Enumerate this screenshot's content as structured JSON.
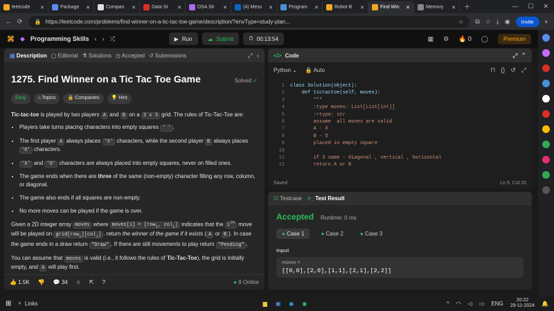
{
  "browser": {
    "tabs": [
      {
        "title": "leetcode",
        "color": "#f5a623"
      },
      {
        "title": "Package",
        "color": "#5b8def"
      },
      {
        "title": "Compan",
        "color": "#e0e0e0"
      },
      {
        "title": "Data St",
        "color": "#d93025"
      },
      {
        "title": "DSA Sh",
        "color": "#a76bf0"
      },
      {
        "title": "(4) Mess",
        "color": "#0a66c2"
      },
      {
        "title": "Program",
        "color": "#4a90d9"
      },
      {
        "title": "Robot B",
        "color": "#f5a623"
      },
      {
        "title": "Find Win",
        "color": "#f5a623"
      },
      {
        "title": "Memory",
        "color": "#888888"
      }
    ],
    "url": "https://leetcode.com/problems/find-winner-on-a-tic-tac-toe-game/description/?envType=study-plan...",
    "invite_label": "Invite"
  },
  "lc": {
    "list_title": "Programming Skills",
    "run": "Run",
    "submit": "Submit",
    "timer": "00:13:54",
    "streak": "0",
    "premium": "Premium"
  },
  "left": {
    "tabs": [
      "Description",
      "Editorial",
      "Solutions",
      "Accepted",
      "Submissions"
    ],
    "title": "1275. Find Winner on a Tic Tac Toe Game",
    "solved": "Solved",
    "tags": [
      "Easy",
      "Topics",
      "Companies",
      "Hint"
    ],
    "footer": {
      "likes": "1.5K",
      "comments": "34",
      "online": "9 Online"
    }
  },
  "editor": {
    "header": "Code",
    "language": "Python",
    "auto": "Auto",
    "status_left": "Saved",
    "status_right": "Ln 5, Col 20",
    "lines": [
      {
        "n": "1",
        "t": "class Solution(object):"
      },
      {
        "n": "2",
        "t": "    def tictactoe(self, moves):"
      },
      {
        "n": "3",
        "t": "        \"\"\""
      },
      {
        "n": "4",
        "t": "        :type moves: List[List[int]]"
      },
      {
        "n": "5",
        "t": "        :rtype: str"
      },
      {
        "n": "6",
        "t": "        assume  all moves are valid"
      },
      {
        "n": "7",
        "t": "        A - X"
      },
      {
        "n": "8",
        "t": "        B - O"
      },
      {
        "n": "9",
        "t": "        placed in empty square"
      },
      {
        "n": "10",
        "t": ""
      },
      {
        "n": "11",
        "t": "        if 3 same - diagonal , vertical , horizontal"
      },
      {
        "n": "12",
        "t": "        return A or B"
      }
    ]
  },
  "test": {
    "tab1": "Testcase",
    "tab2": "Test Result",
    "status": "Accepted",
    "runtime": "Runtime: 0 ms",
    "cases": [
      "Case 1",
      "Case 2",
      "Case 3"
    ],
    "input_label": "Input",
    "var": "moves =",
    "value": "[[0,0],[2,0],[1,1],[2,1],[2,2]]"
  },
  "taskbar": {
    "search": "Links",
    "lang": "ENG",
    "time": "20:22",
    "date": "29-11-2024"
  }
}
